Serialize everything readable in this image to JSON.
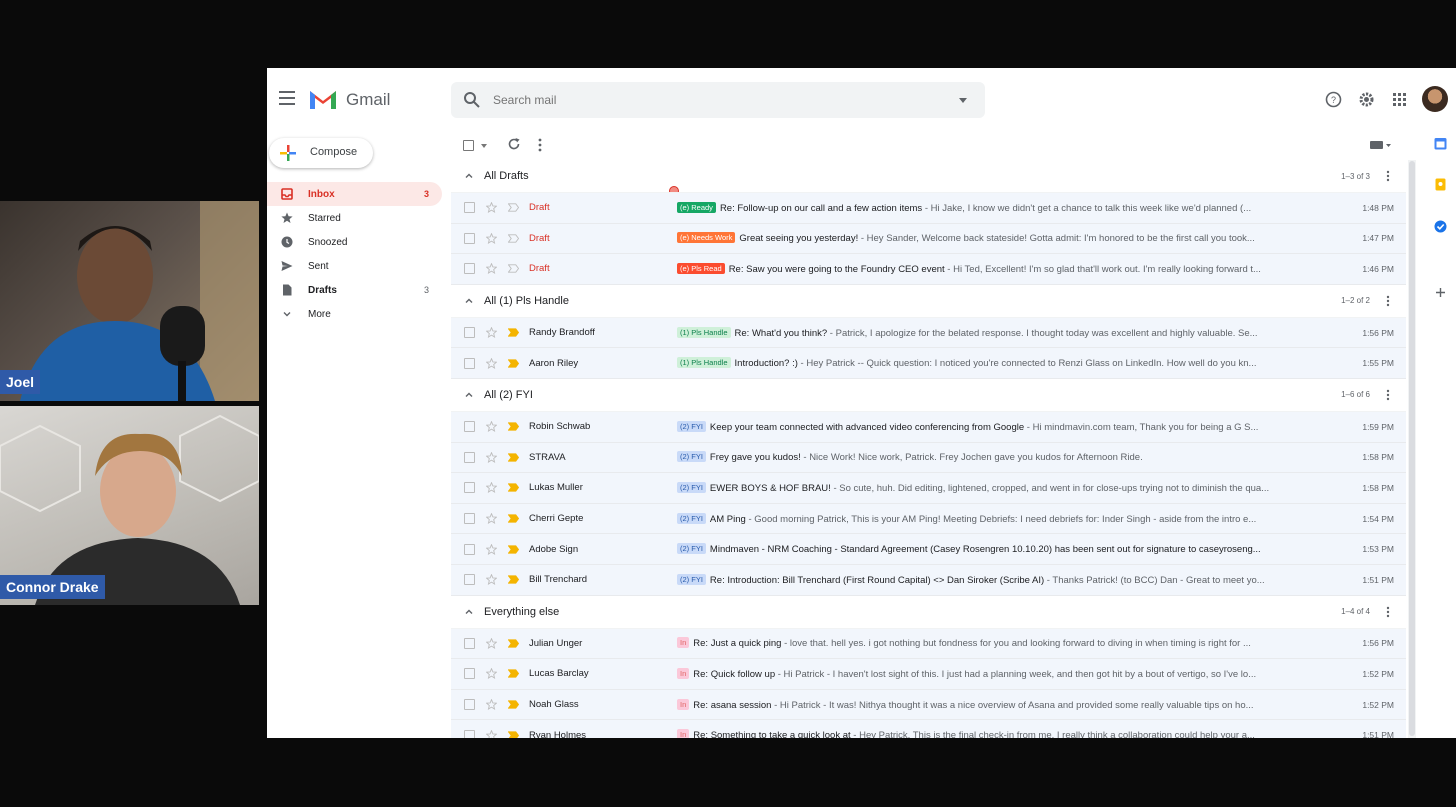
{
  "participants": {
    "joel": {
      "name": "Joel"
    },
    "connor": {
      "name": "Connor Drake"
    }
  },
  "app": {
    "logo_text": "Gmail",
    "search_placeholder": "Search mail"
  },
  "sidebar": {
    "compose_label": "Compose",
    "items": [
      {
        "label": "Inbox",
        "count": "3",
        "icon": "inbox-icon",
        "active": true
      },
      {
        "label": "Starred",
        "count": "",
        "icon": "star-icon"
      },
      {
        "label": "Snoozed",
        "count": "",
        "icon": "clock-icon"
      },
      {
        "label": "Sent",
        "count": "",
        "icon": "send-icon"
      },
      {
        "label": "Drafts",
        "count": "3",
        "icon": "file-icon",
        "bold": true
      },
      {
        "label": "More",
        "count": "",
        "icon": "chevron-down-icon"
      }
    ]
  },
  "sections": [
    {
      "title": "All Drafts",
      "range": "1–3 of 3",
      "rows": [
        {
          "sender": "Draft",
          "draft": true,
          "tag": "(e) Ready",
          "tag_class": "tag-ready",
          "subject": "Re: Follow-up on our call and a few action items",
          "snippet": " - Hi Jake, I know we didn't get a chance to talk this week like we'd planned (...",
          "time": "1:48 PM"
        },
        {
          "sender": "Draft",
          "draft": true,
          "tag": "(e) Needs Work",
          "tag_class": "tag-needs",
          "subject": "Great seeing you yesterday!",
          "snippet": " - Hey Sander, Welcome back stateside! Gotta admit: I'm honored to be the first call you took...",
          "time": "1:47 PM"
        },
        {
          "sender": "Draft",
          "draft": true,
          "tag": "(e) Pls Read",
          "tag_class": "tag-read",
          "subject": "Re: Saw you were going to the Foundry CEO event",
          "snippet": " - Hi Ted, Excellent! I'm so glad that'll work out. I'm really looking forward t...",
          "time": "1:46 PM"
        }
      ]
    },
    {
      "title": "All (1) Pls Handle",
      "range": "1–2 of 2",
      "rows": [
        {
          "sender": "Randy Brandoff",
          "tag": "(1) Pls Handle",
          "tag_class": "tag-pls",
          "subject": "Re: What'd you think?",
          "snippet": " - Patrick, I apologize for the belated response. I thought today was excellent and highly valuable. Se...",
          "time": "1:56 PM"
        },
        {
          "sender": "Aaron Riley",
          "tag": "(1) Pls Handle",
          "tag_class": "tag-pls",
          "subject": "Introduction? :)",
          "snippet": " - Hey Patrick -- Quick question: I noticed you're connected to Renzi Glass on LinkedIn. How well do you kn...",
          "time": "1:55 PM"
        }
      ]
    },
    {
      "title": "All (2) FYI",
      "range": "1–6 of 6",
      "rows": [
        {
          "sender": "Robin Schwab",
          "tag": "(2) FYI",
          "tag_class": "tag-fyi",
          "subject": "Keep your team connected with advanced video conferencing from Google",
          "snippet": " - Hi mindmavin.com team, Thank you for being a G S...",
          "time": "1:59 PM"
        },
        {
          "sender": "STRAVA",
          "tag": "(2) FYI",
          "tag_class": "tag-fyi",
          "subject": "Frey gave you kudos!",
          "snippet": " - Nice Work! Nice work, Patrick. Frey Jochen gave you kudos for Afternoon Ride.",
          "time": "1:58 PM"
        },
        {
          "sender": "Lukas Muller",
          "tag": "(2) FYI",
          "tag_class": "tag-fyi",
          "subject": "EWER BOYS & HOF BRAU!",
          "snippet": " - So cute, huh. Did editing, lightened, cropped, and went in for close-ups trying not to diminish the qua...",
          "time": "1:58 PM"
        },
        {
          "sender": "Cherri Gepte",
          "tag": "(2) FYI",
          "tag_class": "tag-fyi",
          "subject": "AM Ping",
          "snippet": " - Good morning Patrick, This is your AM Ping! Meeting Debriefs: I need debriefs for: Inder Singh - aside from the intro e...",
          "time": "1:54 PM"
        },
        {
          "sender": "Adobe Sign",
          "tag": "(2) FYI",
          "tag_class": "tag-fyi",
          "subject": "Mindmaven - NRM Coaching - Standard Agreement (Casey Rosengren 10.10.20) has been sent out for signature to caseyroseng...",
          "snippet": "",
          "time": "1:53 PM"
        },
        {
          "sender": "Bill Trenchard",
          "tag": "(2) FYI",
          "tag_class": "tag-fyi",
          "subject": "Re: Introduction: Bill Trenchard (First Round Capital) <> Dan Siroker (Scribe AI)",
          "snippet": " - Thanks Patrick! (to BCC) Dan - Great to meet yo...",
          "time": "1:51 PM"
        }
      ]
    },
    {
      "title": "Everything else",
      "range": "1–4 of 4",
      "rows": [
        {
          "sender": "Julian Unger",
          "tag": "In",
          "tag_class": "tag-in",
          "subject": "Re: Just a quick ping",
          "snippet": " - love that. hell yes. i got nothing but fondness for you and looking forward to diving in when timing is right for ...",
          "time": "1:56 PM"
        },
        {
          "sender": "Lucas Barclay",
          "tag": "In",
          "tag_class": "tag-in",
          "subject": "Re: Quick follow up",
          "snippet": " - Hi Patrick - I haven't lost sight of this. I just had a planning week, and then got hit by a bout of vertigo, so I've lo...",
          "time": "1:52 PM"
        },
        {
          "sender": "Noah Glass",
          "tag": "In",
          "tag_class": "tag-in",
          "subject": "Re: asana session",
          "snippet": " - Hi Patrick - It was! Nithya thought it was a nice overview of Asana and provided some really valuable tips on ho...",
          "time": "1:52 PM"
        },
        {
          "sender": "Ryan Holmes",
          "tag": "In",
          "tag_class": "tag-in",
          "subject": "Re: Something to take a quick look at",
          "snippet": " - Hey Patrick, This is the final check-in from me. I really think a collaboration could help your a...",
          "time": "1:51 PM"
        }
      ]
    }
  ]
}
